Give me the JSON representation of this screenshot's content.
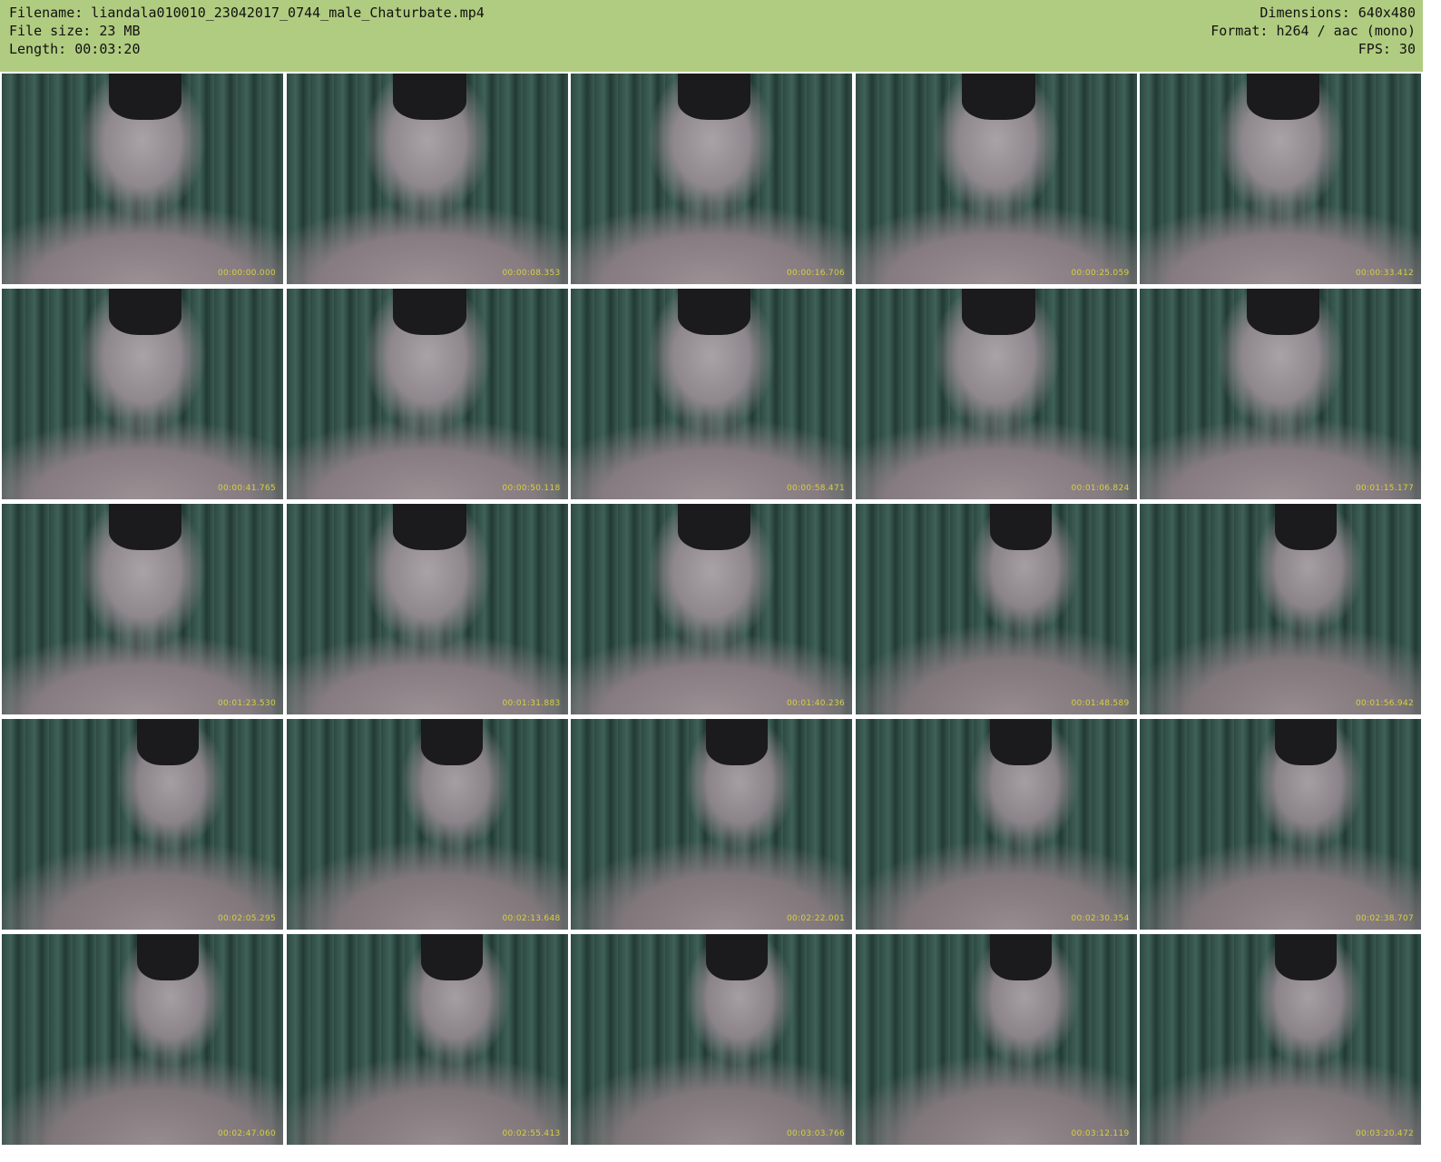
{
  "header": {
    "filename_label": "Filename: liandala010010_23042017_0744_male_Chaturbate.mp4",
    "filesize_label": "File size: 23 MB",
    "length_label": "Length: 00:03:20",
    "dimensions_label": "Dimensions: 640x480",
    "format_label": "Format: h264 / aac (mono)",
    "fps_label": "FPS: 30"
  },
  "thumbnails": [
    "00:00:00.000",
    "00:00:08.353",
    "00:00:16.706",
    "00:00:25.059",
    "00:00:33.412",
    "00:00:41.765",
    "00:00:50.118",
    "00:00:58.471",
    "00:01:06.824",
    "00:01:15.177",
    "00:01:23.530",
    "00:01:31.883",
    "00:01:40.236",
    "00:01:48.589",
    "00:01:56.942",
    "00:02:05.295",
    "00:02:13.648",
    "00:02:22.001",
    "00:02:30.354",
    "00:02:38.707",
    "00:02:47.060",
    "00:02:55.413",
    "00:03:03.766",
    "00:03:12.119",
    "00:03:20.472"
  ]
}
